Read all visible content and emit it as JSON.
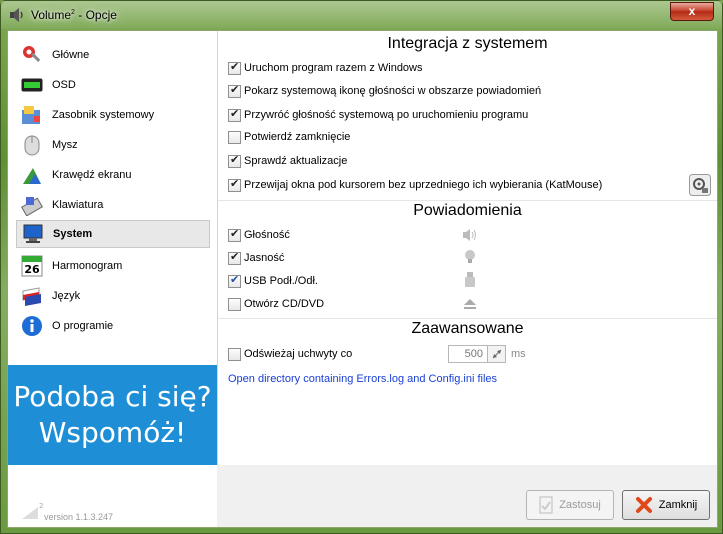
{
  "window": {
    "title_main": "Volume",
    "title_sup": "2",
    "title_rest": " - Opcje",
    "close_label": "x"
  },
  "sidebar": {
    "items": [
      {
        "label": "Główne",
        "icon": "settings-wrench-icon"
      },
      {
        "label": "OSD",
        "icon": "osd-bar-icon"
      },
      {
        "label": "Zasobnik systemowy",
        "icon": "tray-icon"
      },
      {
        "label": "Mysz",
        "icon": "mouse-icon"
      },
      {
        "label": "Krawędź ekranu",
        "icon": "screen-edge-icon"
      },
      {
        "label": "Klawiatura",
        "icon": "keyboard-icon"
      },
      {
        "label": "System",
        "icon": "computer-icon",
        "selected": true
      },
      {
        "label": "Harmonogram",
        "icon": "calendar-icon",
        "day": "26"
      },
      {
        "label": "Język",
        "icon": "flag-icon"
      },
      {
        "label": "O programie",
        "icon": "info-icon"
      }
    ],
    "banner_line1": "Podoba ci się?",
    "banner_line2": "Wspomóż!",
    "version": "version 1.1.3.247",
    "version_logo_sup": "2"
  },
  "integration": {
    "title": "Integracja z systemem",
    "options": [
      {
        "label": "Uruchom program razem z Windows",
        "checked": true
      },
      {
        "label": "Pokarz systemową ikonę głośności w obszarze powiadomień",
        "checked": true
      },
      {
        "label": "Przywróć głośność systemową po uruchomieniu programu",
        "checked": true
      },
      {
        "label": "Potwierdź zamknięcie",
        "checked": false
      },
      {
        "label": "Sprawdź aktualizacje",
        "checked": true
      },
      {
        "label": "Przewijaj okna pod kursorem bez uprzedniego ich wybierania (KatMouse)",
        "checked": true
      }
    ]
  },
  "notifications": {
    "title": "Powiadomienia",
    "options": [
      {
        "label": "Głośność",
        "checked": true,
        "icon": "speaker-icon"
      },
      {
        "label": "Jasność",
        "checked": true,
        "icon": "lightbulb-icon"
      },
      {
        "label": "USB Podł./Odł.",
        "checked": true,
        "icon": "usb-icon"
      },
      {
        "label": "Otwórz CD/DVD",
        "checked": false,
        "icon": "eject-icon"
      }
    ]
  },
  "advanced": {
    "title": "Zaawansowane",
    "refresh_label": "Odświeżaj uchwyty co",
    "refresh_checked": false,
    "refresh_value": "500",
    "refresh_unit": "ms",
    "link_text": "Open directory containing Errors.log and Config.ini files"
  },
  "buttons": {
    "apply": "Zastosuj",
    "close": "Zamknij"
  },
  "colors": {
    "banner_bg": "#1e8fd6",
    "link": "#1a3fd6",
    "close_red": "#c7452f"
  }
}
